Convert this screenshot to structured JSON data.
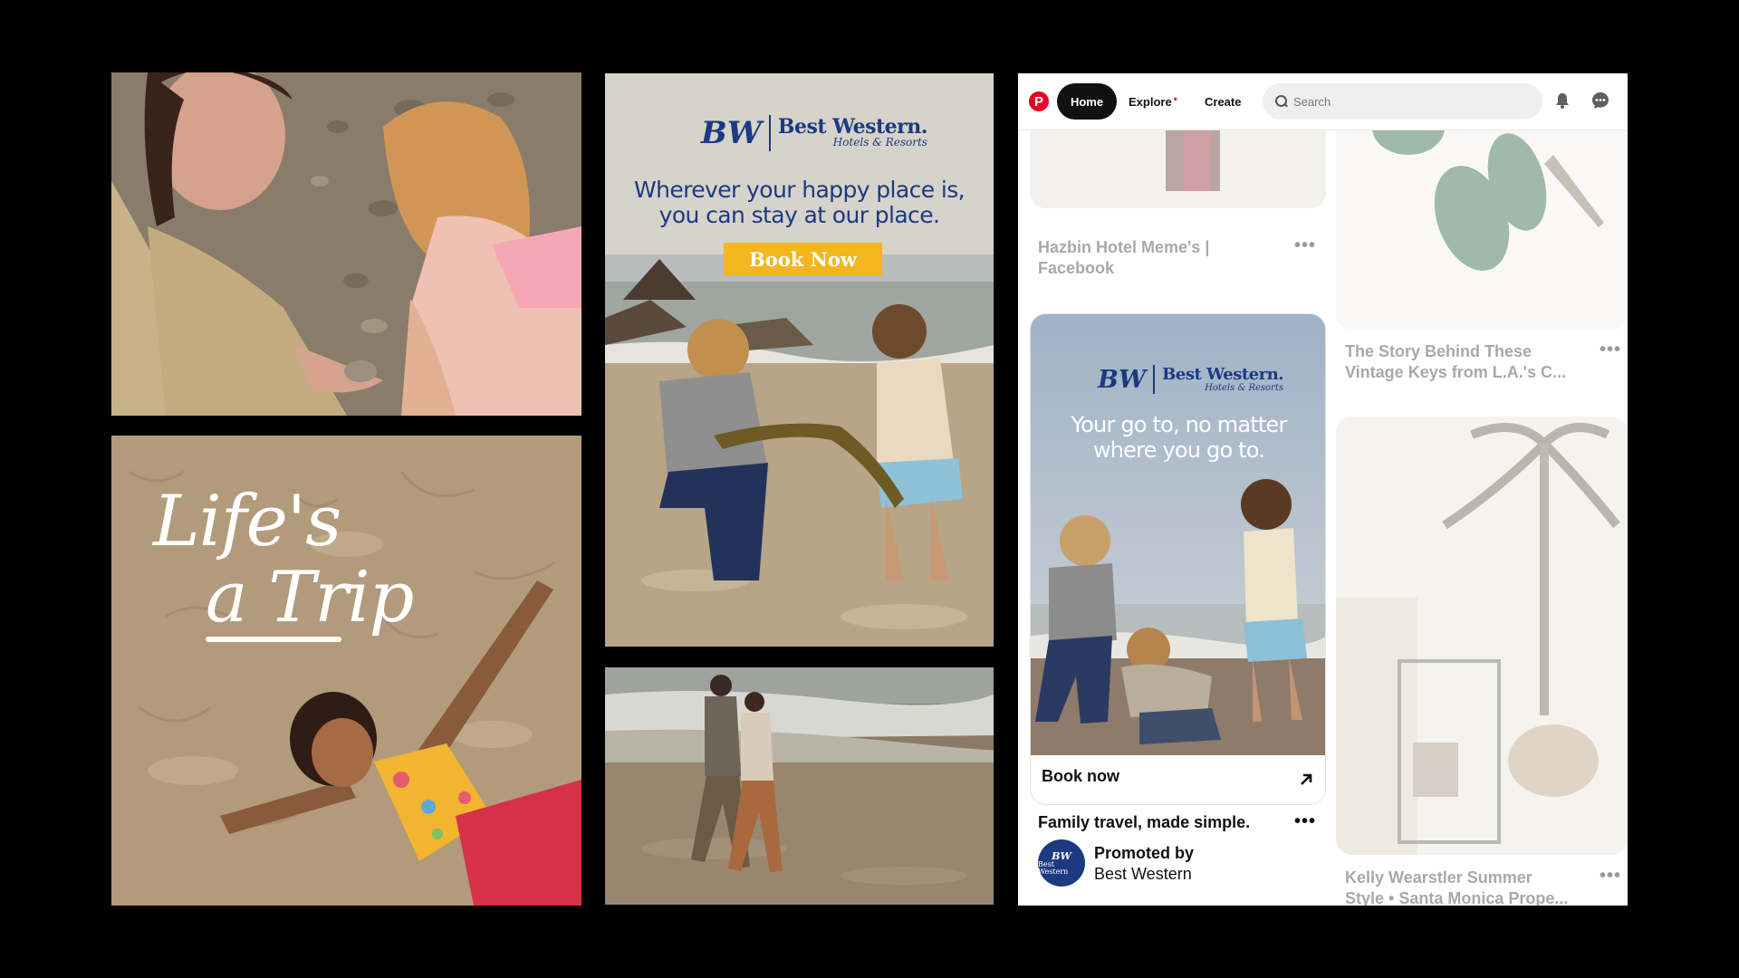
{
  "panel_lifes_a_trip": {
    "line1": "Life's",
    "line2": "a Trip"
  },
  "bw_ad_main": {
    "logo_mark": "BW",
    "brand": "Best Western.",
    "brand_sub": "Hotels & Resorts",
    "headline_line1": "Wherever your happy place is,",
    "headline_line2": "you can stay at our place.",
    "cta": "Book Now"
  },
  "pinterest": {
    "logo": "P",
    "nav": {
      "home": "Home",
      "explore": "Explore",
      "explore_dot": "•",
      "create": "Create"
    },
    "search_placeholder": "Search",
    "pins": [
      {
        "title_line1": "Hazbin Hotel Meme's |",
        "title_line2": "Facebook",
        "more": "•••"
      },
      {
        "title_line1": "The Story Behind These",
        "title_line2": "Vintage Keys from L.A.'s C...",
        "more": "•••"
      },
      {
        "title_line1": "Kelly Wearstler Summer",
        "title_line2": "Style • Santa Monica Prope...",
        "more": "•••"
      }
    ],
    "ad": {
      "logo_mark": "BW",
      "brand": "Best Western.",
      "brand_sub": "Hotels & Resorts",
      "headline_line1": "Your go to, no matter",
      "headline_line2": "where you go to.",
      "cta": "Book now",
      "title": "Family travel, made simple.",
      "more": "•••",
      "promoted_label": "Promoted by",
      "advertiser": "Best Western",
      "avatar_mark": "BW",
      "avatar_sub": "Best Western"
    }
  },
  "colors": {
    "background": "#000000",
    "bw_blue": "#1c3a82",
    "cta_yellow": "#f4b51f",
    "pinterest_red": "#e60023"
  }
}
